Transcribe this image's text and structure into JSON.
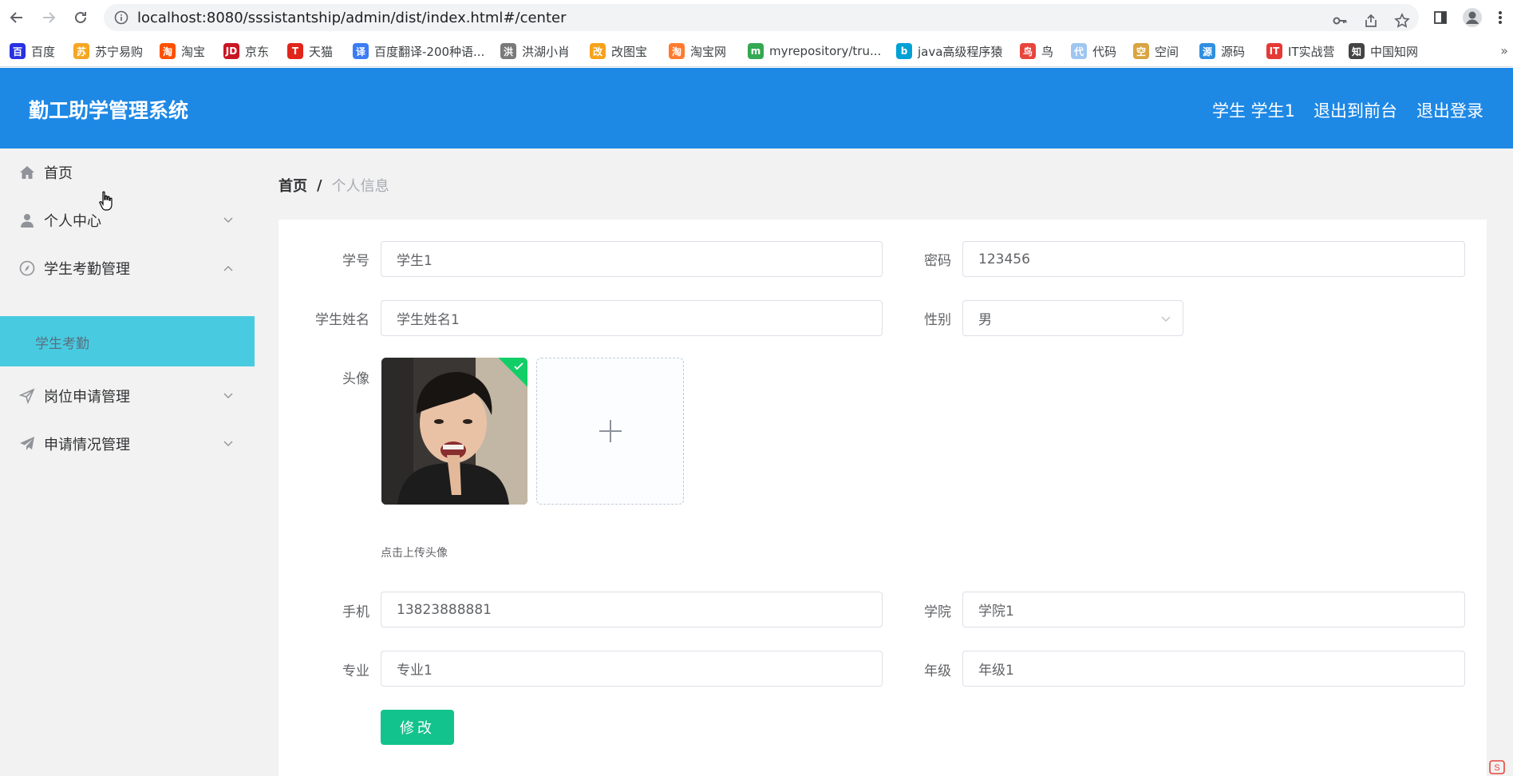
{
  "browser": {
    "url": "localhost:8080/sssistantship/admin/dist/index.html#/center",
    "bookmarks": [
      {
        "label": "百度",
        "icon": "baidu-icon",
        "color": "#2932e1",
        "glyph": "百"
      },
      {
        "label": "苏宁易购",
        "icon": "suning-icon",
        "color": "#f5a623",
        "glyph": "苏"
      },
      {
        "label": "淘宝",
        "icon": "taobao-icon",
        "color": "#ff5000",
        "glyph": "淘"
      },
      {
        "label": "京东",
        "icon": "jd-icon",
        "color": "#c91623",
        "glyph": "JD"
      },
      {
        "label": "天猫",
        "icon": "tmall-icon",
        "color": "#e1251b",
        "glyph": "T"
      },
      {
        "label": "百度翻译-200种语...",
        "icon": "translate-icon",
        "color": "#3b7cf5",
        "glyph": "译"
      },
      {
        "label": "洪湖小肖",
        "icon": "hhxx-icon",
        "color": "#7a7a7a",
        "glyph": "洪"
      },
      {
        "label": "改图宝",
        "icon": "gaitubao-icon",
        "color": "#f7a21b",
        "glyph": "改"
      },
      {
        "label": "淘宝网",
        "icon": "taobaowang-icon",
        "color": "#ff7a2f",
        "glyph": "淘"
      },
      {
        "label": "myrepository/tru...",
        "icon": "chrome-icon",
        "color": "#34a853",
        "glyph": "m"
      },
      {
        "label": "java高级程序猿",
        "icon": "bilibili-icon",
        "color": "#00a1d6",
        "glyph": "b"
      },
      {
        "label": "鸟",
        "icon": "bird-icon",
        "color": "#e8453c",
        "glyph": "鸟"
      },
      {
        "label": "代码",
        "icon": "code-icon",
        "color": "#9ec6f0",
        "glyph": "代"
      },
      {
        "label": "空间",
        "icon": "space-icon",
        "color": "#d9a441",
        "glyph": "空"
      },
      {
        "label": "源码",
        "icon": "source-icon",
        "color": "#2f8fe0",
        "glyph": "源"
      },
      {
        "label": "IT实战营",
        "icon": "it-icon",
        "color": "#e53935",
        "glyph": "IT"
      },
      {
        "label": "中国知网",
        "icon": "cnki-icon",
        "color": "#444444",
        "glyph": "知"
      }
    ],
    "more": "»"
  },
  "header": {
    "title": "勤工助学管理系统",
    "user": "学生 学生1",
    "to_front": "退出到前台",
    "logout": "退出登录",
    "bg_color": "#1e88e5"
  },
  "sidebar": {
    "items": [
      {
        "label": "首页",
        "icon": "home-icon"
      },
      {
        "label": "个人中心",
        "icon": "user-icon"
      },
      {
        "label": "学生考勤管理",
        "icon": "compass-icon"
      },
      {
        "label": "岗位申请管理",
        "icon": "send-icon"
      },
      {
        "label": "申请情况管理",
        "icon": "paper-plane-icon"
      }
    ],
    "submenu": {
      "label": "学生考勤",
      "active_color": "#48cbe0"
    }
  },
  "breadcrumb": {
    "home": "首页",
    "separator": "/",
    "current": "个人信息"
  },
  "form": {
    "student_no": {
      "label": "学号",
      "value": "学生1"
    },
    "password": {
      "label": "密码",
      "value": "123456"
    },
    "name": {
      "label": "学生姓名",
      "value": "学生姓名1"
    },
    "gender": {
      "label": "性别",
      "value": "男"
    },
    "avatar": {
      "label": "头像",
      "tip": "点击上传头像"
    },
    "phone": {
      "label": "手机",
      "value": "13823888881"
    },
    "college": {
      "label": "学院",
      "value": "学院1"
    },
    "major": {
      "label": "专业",
      "value": "专业1"
    },
    "grade": {
      "label": "年级",
      "value": "年级1"
    },
    "submit": "修改",
    "submit_color": "#13c38d"
  }
}
